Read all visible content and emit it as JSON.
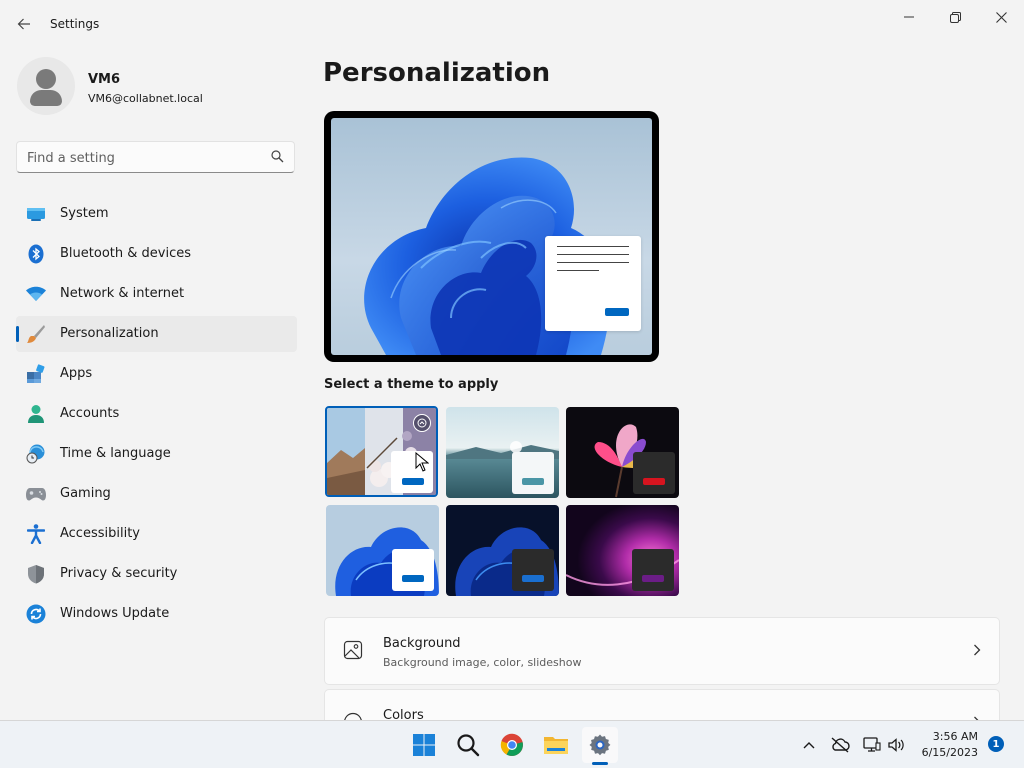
{
  "window": {
    "title": "Settings"
  },
  "profile": {
    "name": "VM6",
    "email": "VM6@collabnet.local"
  },
  "search": {
    "placeholder": "Find a setting",
    "value": ""
  },
  "sidebar": {
    "items": [
      {
        "label": "System",
        "icon": "monitor-icon",
        "active": false
      },
      {
        "label": "Bluetooth & devices",
        "icon": "bluetooth-icon",
        "active": false
      },
      {
        "label": "Network & internet",
        "icon": "wifi-icon",
        "active": false
      },
      {
        "label": "Personalization",
        "icon": "paintbrush-icon",
        "active": true
      },
      {
        "label": "Apps",
        "icon": "apps-icon",
        "active": false
      },
      {
        "label": "Accounts",
        "icon": "person-icon",
        "active": false
      },
      {
        "label": "Time & language",
        "icon": "globe-clock-icon",
        "active": false
      },
      {
        "label": "Gaming",
        "icon": "gamepad-icon",
        "active": false
      },
      {
        "label": "Accessibility",
        "icon": "accessibility-icon",
        "active": false
      },
      {
        "label": "Privacy & security",
        "icon": "shield-icon",
        "active": false
      },
      {
        "label": "Windows Update",
        "icon": "refresh-icon",
        "active": false
      }
    ]
  },
  "main": {
    "title": "Personalization",
    "themes_label": "Select a theme to apply",
    "themes": [
      {
        "id": "custom",
        "selected": true
      },
      {
        "id": "glow-lake",
        "selected": false
      },
      {
        "id": "captured-motion",
        "selected": false
      },
      {
        "id": "windows-light",
        "selected": false
      },
      {
        "id": "windows-dark",
        "selected": false
      },
      {
        "id": "flow",
        "selected": false
      }
    ],
    "cards": [
      {
        "title": "Background",
        "subtitle": "Background image, color, slideshow",
        "icon": "image-icon"
      },
      {
        "title": "Colors",
        "subtitle": "",
        "icon": "palette-icon"
      }
    ]
  },
  "taskbar": {
    "apps": [
      "start-icon",
      "search-icon",
      "chrome-icon",
      "file-explorer-icon",
      "settings-icon"
    ],
    "active_app": "settings-icon",
    "time": "3:56 AM",
    "date": "6/15/2023",
    "notification_count": "1"
  },
  "colors": {
    "accent": "#005fb8",
    "background": "#f3f3f3",
    "card": "#fbfbfb"
  }
}
